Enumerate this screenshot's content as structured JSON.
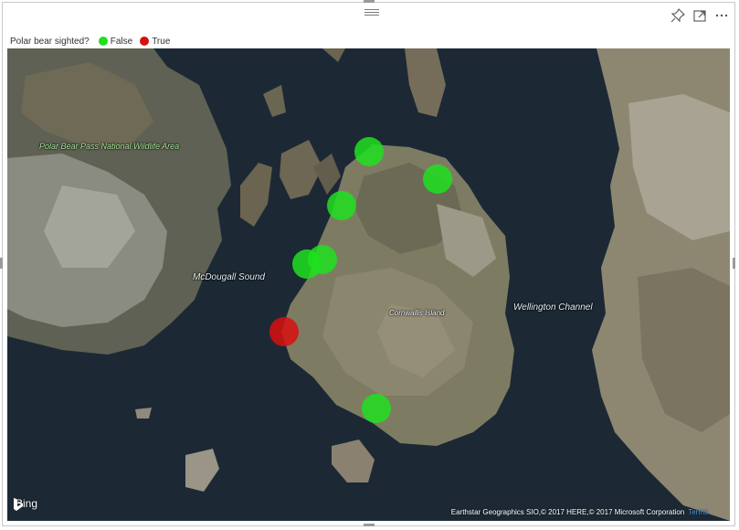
{
  "legend": {
    "title": "Polar bear sighted?",
    "items": [
      {
        "label": "False",
        "color": "#1ee01e"
      },
      {
        "label": "True",
        "color": "#d80f0f"
      }
    ]
  },
  "toolbar": {
    "icons": [
      "pin-icon",
      "focus-mode-icon",
      "more-options-icon"
    ]
  },
  "map": {
    "labels": {
      "park": "Polar Bear Pass National Wildlife Area",
      "mcdougall": "McDougall Sound",
      "wellington": "Wellington Channel",
      "cornwallis": "Cornwallis Island"
    },
    "markers": [
      {
        "sighted": "False",
        "lat": 75.12,
        "lon": -95.5
      },
      {
        "sighted": "False",
        "lat": 75.06,
        "lon": -94.6
      },
      {
        "sighted": "False",
        "lat": 75.0,
        "lon": -95.85
      },
      {
        "sighted": "False",
        "lat": 74.88,
        "lon": -96.1
      },
      {
        "sighted": "False",
        "lat": 74.87,
        "lon": -96.3
      },
      {
        "sighted": "True",
        "lat": 74.72,
        "lon": -96.6
      },
      {
        "sighted": "False",
        "lat": 74.55,
        "lon": -95.4
      }
    ],
    "provider": "Bing",
    "attribution": "Earthstar Geographics SIO,© 2017 HERE,© 2017 Microsoft Corporation",
    "terms": "Terms"
  }
}
